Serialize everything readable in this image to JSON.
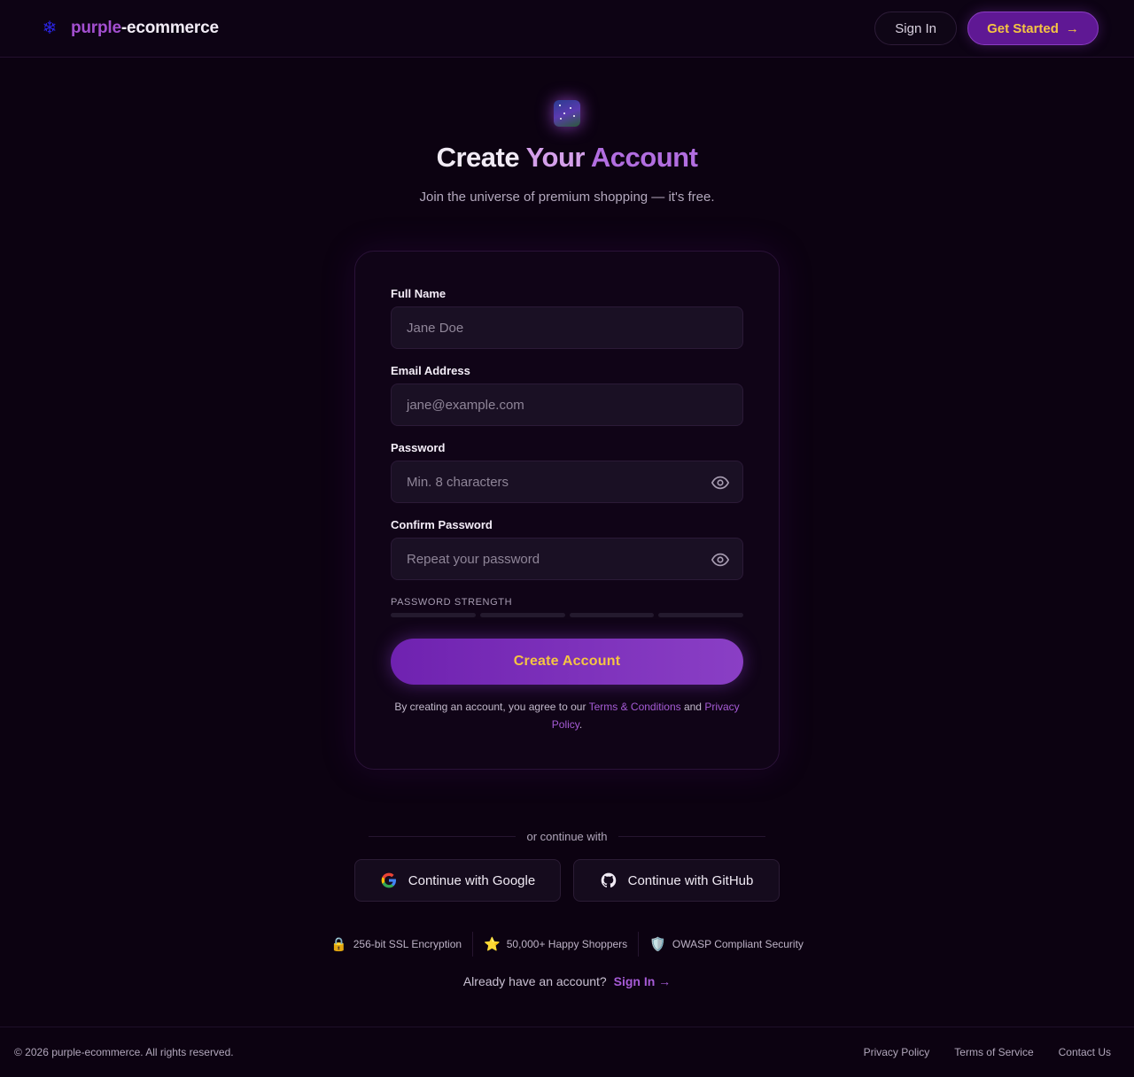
{
  "header": {
    "brand_part1": "purple",
    "brand_part2": "-ecommerce",
    "brand_icon": "snowflake-icon",
    "signin_label": "Sign In",
    "get_started_label": "Get Started",
    "get_started_arrow": "→"
  },
  "hero": {
    "icon": "galaxy-icon",
    "title_part1": "Create ",
    "title_part2": "Your ",
    "title_part3": "Account",
    "subtitle": "Join the universe of premium shopping — it's free."
  },
  "form": {
    "full_name": {
      "label": "Full Name",
      "placeholder": "Jane Doe"
    },
    "email": {
      "label": "Email Address",
      "placeholder": "jane@example.com"
    },
    "password": {
      "label": "Password",
      "placeholder": "Min. 8 characters"
    },
    "confirm_password": {
      "label": "Confirm Password",
      "placeholder": "Repeat your password"
    },
    "strength_label": "PASSWORD STRENGTH",
    "strength_level": 0,
    "submit_label": "Create Account",
    "legal_prefix": "By creating an account, you agree to our ",
    "terms_link": "Terms & Conditions",
    "legal_and": " and ",
    "privacy_link": "Privacy Policy",
    "legal_suffix": "."
  },
  "social": {
    "divider_text": "or continue with",
    "google_label": "Continue with Google",
    "github_label": "Continue with GitHub"
  },
  "badges": [
    {
      "icon": "🔒",
      "label": "256-bit SSL Encryption"
    },
    {
      "icon": "⭐",
      "label": "50,000+ Happy Shoppers"
    },
    {
      "icon": "🛡️",
      "label": "OWASP Compliant Security"
    }
  ],
  "signin_prompt": {
    "text": "Already have an account?",
    "link": "Sign In →"
  },
  "footer": {
    "copyright": "© 2026 purple-ecommerce. All rights reserved.",
    "links": [
      "Privacy Policy",
      "Terms of Service",
      "Contact Us"
    ]
  },
  "colors": {
    "background": "#0c0211",
    "accent": "#a34fd0",
    "button_text": "#f5c542"
  }
}
